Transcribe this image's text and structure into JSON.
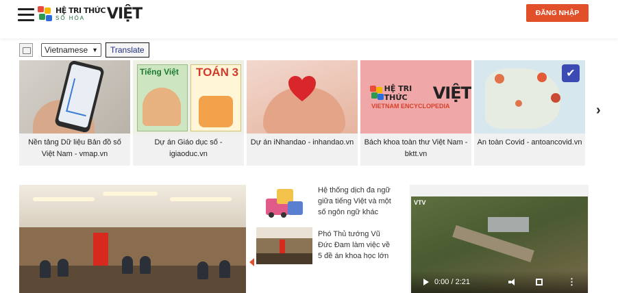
{
  "header": {
    "logo": {
      "line1": "HỆ TRI THỨC",
      "line2": "SỐ HÓA",
      "word": "VIỆT"
    },
    "login_label": "ĐĂNG NHẬP"
  },
  "translate": {
    "language": "Vietnamese",
    "button_label": "Translate"
  },
  "cards": [
    {
      "caption": "Nền tảng Dữ liệu Bản đồ số Việt Nam - vmap.vn",
      "icon": "map-phone-image"
    },
    {
      "caption": "Dự án Giáo dục số - igiaoduc.vn",
      "icon": "textbooks-image",
      "book1": "Tiếng Việt",
      "book2": "TOÁN 3"
    },
    {
      "caption": "Dự án iNhandao - inhandao.vn",
      "icon": "heart-hands-image"
    },
    {
      "caption": "Bách khoa toàn thư Việt Nam - bktt.vn",
      "icon": "encyclopedia-logo-image",
      "logo_line1": "HỆ TRI THỨC",
      "logo_word": "VIỆT",
      "sub": "VIETNAM ENCYCLOPEDIA"
    },
    {
      "caption": "An toàn Covid - antoancovid.vn",
      "icon": "covid-map-image"
    }
  ],
  "news": [
    {
      "title": "Hệ thống dịch đa ngữ giữa tiếng Việt và một số ngôn ngữ khác",
      "icon": "translation-illustration"
    },
    {
      "title": "Phó Thủ tướng Vũ Đức Đam làm việc về 5 đề án khoa học lớn",
      "icon": "meeting-photo"
    }
  ],
  "video": {
    "time": "0:00 / 2:21",
    "channel": "VTV"
  },
  "colors": {
    "accent": "#e2502a",
    "card_bg": "#f1f1f1",
    "encyclopedia_bg": "#efa7a7"
  }
}
